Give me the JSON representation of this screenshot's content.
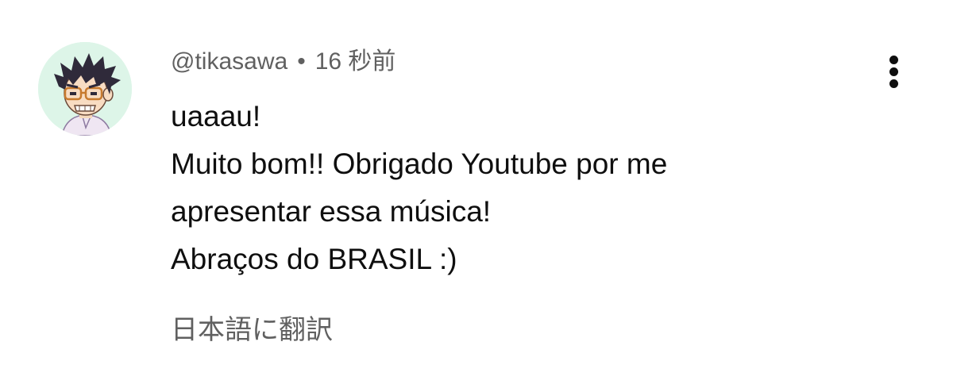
{
  "comment": {
    "author": "@tikasawa",
    "separator": "•",
    "timestamp": "16 秒前",
    "lines": [
      "uaaau!",
      "Muito bom!! Obrigado Youtube por me",
      "apresentar essa música!",
      "Abraços do BRASIL :)"
    ],
    "translate_label": "日本語に翻訳",
    "avatar_bg_color": "#ddf5e8",
    "text_color": "#0f0f0f",
    "meta_color": "#606060",
    "menu_icon": "more-vertical-icon"
  }
}
